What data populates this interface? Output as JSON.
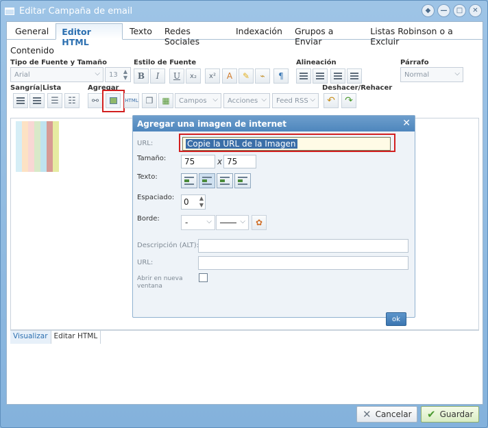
{
  "window": {
    "title": "Editar Campaña de email"
  },
  "tabs": [
    "General",
    "Editor HTML",
    "Texto",
    "Redes Sociales",
    "Indexación",
    "Grupos a Enviar",
    "Listas Robinson o a Excluir"
  ],
  "active_tab": "Editor HTML",
  "section_label": "Contenido",
  "toolbar": {
    "font_group": "Tipo de Fuente y Tamaño",
    "font_value": "Arial",
    "size_value": "13",
    "style_group": "Estilo de Fuente",
    "align_group": "Alineación",
    "paragraph_group": "Párrafo",
    "paragraph_value": "Normal",
    "indent_group": "Sangría|Lista",
    "add_group": "Agregar",
    "fields_label": "Campos",
    "actions_label": "Acciones",
    "feed_label": "Feed RSS",
    "undo_group": "Deshacer/Rehacer",
    "bold": "B",
    "italic": "I",
    "underline": "U",
    "sub": "x₂",
    "sup": "x²",
    "pilcrow": "¶"
  },
  "editor": {
    "stripe_colors": [
      "#d6eef6",
      "#fde2c4",
      "#f8d7d4",
      "#d8e9c8",
      "#bfe3ee",
      "#d79a93",
      "#e6eba1"
    ]
  },
  "mode_tabs": {
    "preview": "Visualizar",
    "html": "Editar HTML"
  },
  "dialog": {
    "title": "Agregar una imagen de internet",
    "url_label": "URL:",
    "url_value": "Copie la URL de la Imagen",
    "size_label": "Tamaño:",
    "width": "75",
    "height": "75",
    "by": "x",
    "text_label": "Texto:",
    "spacing_label": "Espaciado:",
    "spacing_value": "0",
    "border_label": "Borde:",
    "border_value": "-",
    "alt_label": "Descripción (ALT):",
    "link_url_label": "URL:",
    "new_window_label_1": "Abrir en nueva",
    "new_window_label_2": "ventana",
    "ok": "ok"
  },
  "footer": {
    "cancel": "Cancelar",
    "save": "Guardar"
  }
}
